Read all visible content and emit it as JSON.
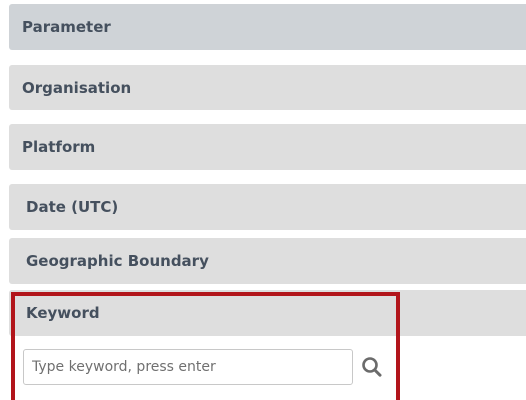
{
  "sections": {
    "parameter": {
      "label": "Parameter"
    },
    "organisation": {
      "label": "Organisation"
    },
    "platform": {
      "label": "Platform"
    },
    "date": {
      "label": "Date (UTC)"
    },
    "geographic_boundary": {
      "label": "Geographic Boundary"
    },
    "keyword": {
      "label": "Keyword",
      "input_value": "",
      "input_placeholder": "Type keyword, press enter",
      "search_icon": "search-icon"
    }
  },
  "colors": {
    "section_bg": "#dedede",
    "active_section_bg": "#cfd3d7",
    "label_text": "#45505e",
    "highlight_border": "#b2151b",
    "icon": "#6b6b6b"
  }
}
